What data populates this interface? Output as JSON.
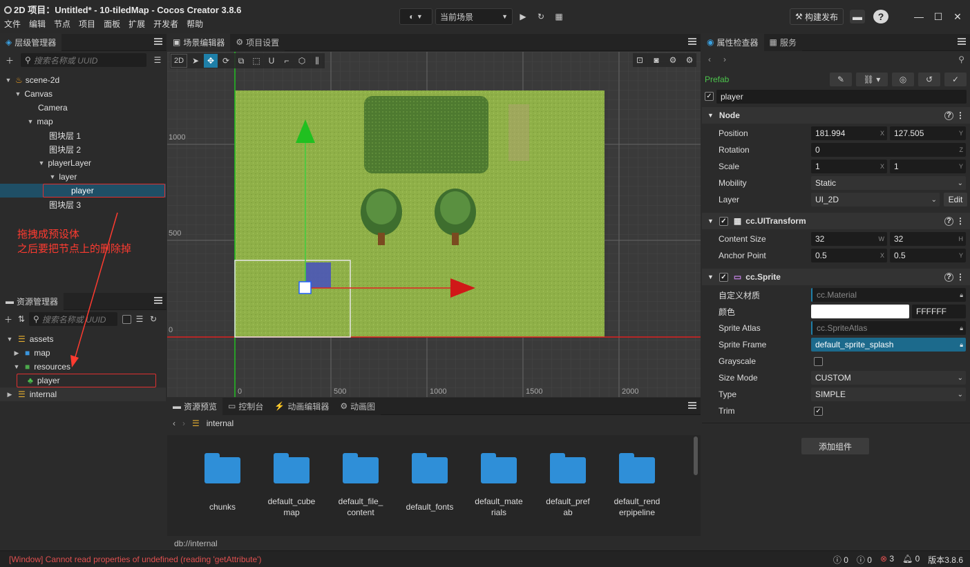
{
  "title": "2D 项目：Untitled* - 10-tiledMap - Cocos Creator 3.8.6",
  "menu": [
    "文件",
    "编辑",
    "节点",
    "项目",
    "面板",
    "扩展",
    "开发者",
    "帮助"
  ],
  "scene_selector": "当前场景",
  "build_label": "构建发布",
  "hierarchy": {
    "tab": "层级管理器",
    "search_placeholder": "搜索名称或 UUID",
    "nodes": [
      {
        "label": "scene-2d"
      },
      {
        "label": "Canvas"
      },
      {
        "label": "Camera"
      },
      {
        "label": "map"
      },
      {
        "label": "图块层 1"
      },
      {
        "label": "图块层 2"
      },
      {
        "label": "playerLayer"
      },
      {
        "label": "layer"
      },
      {
        "label": "player"
      },
      {
        "label": "图块层 3"
      }
    ]
  },
  "annotation": {
    "line1": "拖拽成预设体",
    "line2": "之后要把节点上的删除掉"
  },
  "assets": {
    "tab": "资源管理器",
    "search_placeholder": "搜索名称或 UUID",
    "items": [
      {
        "label": "assets"
      },
      {
        "label": "map"
      },
      {
        "label": "resources"
      },
      {
        "label": "player"
      },
      {
        "label": "internal"
      }
    ]
  },
  "scene_editor": {
    "tabs": [
      "场景编辑器",
      "项目设置"
    ],
    "mode": "2D",
    "y_labels": [
      "1000",
      "500",
      "0"
    ],
    "x_labels": [
      "0",
      "500",
      "1000",
      "1500",
      "2000"
    ]
  },
  "bottom": {
    "tabs": [
      "资源预览",
      "控制台",
      "动画编辑器",
      "动画图"
    ],
    "path": "internal",
    "footer": "db://internal",
    "folders": [
      {
        "l1": "chunks",
        "l2": ""
      },
      {
        "l1": "default_cube",
        "l2": "map"
      },
      {
        "l1": "default_file_",
        "l2": "content"
      },
      {
        "l1": "default_fonts",
        "l2": ""
      },
      {
        "l1": "default_mate",
        "l2": "rials"
      },
      {
        "l1": "default_pref",
        "l2": "ab"
      },
      {
        "l1": "default_rend",
        "l2": "erpipeline"
      }
    ]
  },
  "inspector": {
    "tabs": [
      "属性检查器",
      "服务"
    ],
    "prefab_label": "Prefab",
    "node_name": "player",
    "node_section": "Node",
    "position": {
      "label": "Position",
      "x": "181.994",
      "y": "127.505"
    },
    "rotation": {
      "label": "Rotation",
      "z": "0"
    },
    "scale": {
      "label": "Scale",
      "x": "1",
      "y": "1"
    },
    "mobility": {
      "label": "Mobility",
      "value": "Static"
    },
    "layer": {
      "label": "Layer",
      "value": "UI_2D",
      "edit": "Edit"
    },
    "uitransform": "cc.UITransform",
    "content_size": {
      "label": "Content Size",
      "w": "32",
      "h": "32"
    },
    "anchor": {
      "label": "Anchor Point",
      "x": "0.5",
      "y": "0.5"
    },
    "sprite": "cc.Sprite",
    "custom_material": {
      "label": "自定义材质",
      "value": "cc.Material"
    },
    "color": {
      "label": "颜色",
      "hex": "FFFFFF"
    },
    "atlas": {
      "label": "Sprite Atlas",
      "value": "cc.SpriteAtlas"
    },
    "frame": {
      "label": "Sprite Frame",
      "value": "default_sprite_splash"
    },
    "grayscale": {
      "label": "Grayscale"
    },
    "size_mode": {
      "label": "Size Mode",
      "value": "CUSTOM"
    },
    "type": {
      "label": "Type",
      "value": "SIMPLE"
    },
    "trim": {
      "label": "Trim"
    },
    "add_component": "添加组件",
    "axis": {
      "x": "X",
      "y": "Y",
      "z": "Z",
      "w": "W",
      "h": "H"
    }
  },
  "status": {
    "error": "[Window] Cannot read properties of undefined (reading 'getAttribute')",
    "c1": "0",
    "c2": "0",
    "c3": "3",
    "c4": "0",
    "version": "版本3.8.6"
  },
  "colors": {
    "accent": "#1e7fa8",
    "selected_row": "#1f4f66",
    "error": "#e05050",
    "annotation": "#ff3b30"
  }
}
